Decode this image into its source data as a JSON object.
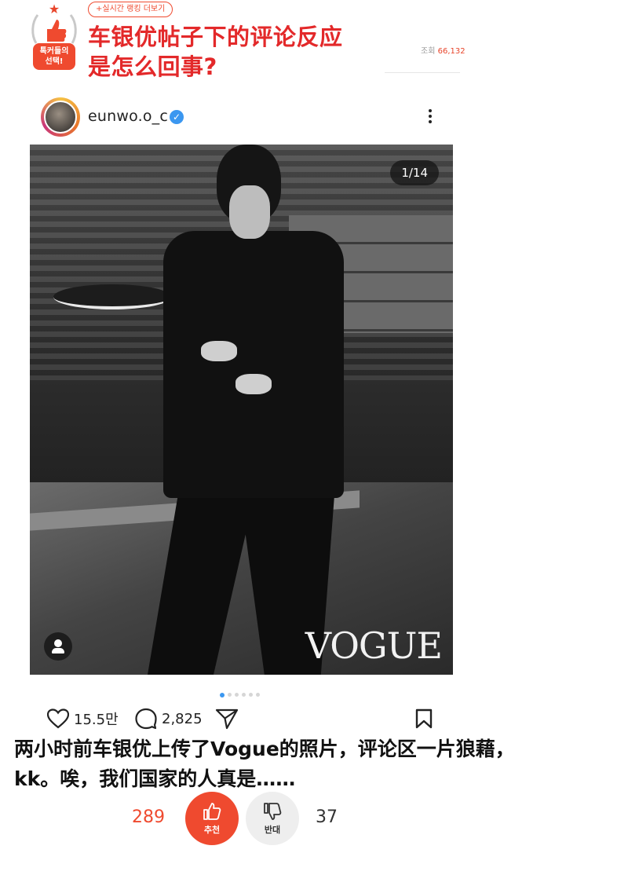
{
  "badge": {
    "label_line1": "톡커들의",
    "label_line2": "선택!"
  },
  "header": {
    "rank_link": "+실시간 랭킹 더보기",
    "title_line1": "车银优帖子下的评论反应",
    "title_line2": "是怎么回事?",
    "views_label": "조회",
    "views_count": "66,132"
  },
  "post": {
    "username": "eunwo.o_c",
    "verified_icon": "verified-check-icon",
    "more_icon": "more-vertical-icon",
    "image_counter": "1/14",
    "watermark": "VOGUE",
    "tag_icon": "user-tag-icon",
    "carousel_dots": 6,
    "carousel_active": 1,
    "likes": "15.5만",
    "comments": "2,825",
    "like_icon": "heart-icon",
    "comment_icon": "comment-bubble-icon",
    "share_icon": "send-icon",
    "save_icon": "bookmark-icon"
  },
  "caption": {
    "line1": "两小时前车银优上传了Vogue的照片，评论区一片狼藉，",
    "line2": "kk。唉，我们国家的人真是……"
  },
  "vote": {
    "up_count": "289",
    "up_label": "추천",
    "down_label": "반대",
    "down_count": "37",
    "up_color": "#ef4a2f",
    "title_color": "#e3292a"
  }
}
